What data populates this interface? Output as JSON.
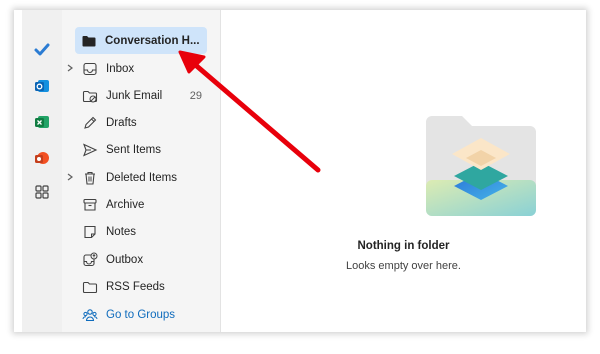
{
  "folders": [
    {
      "label": "Conversation H...",
      "icon": "folder-icon",
      "selected": true,
      "chevron": false
    },
    {
      "label": "Inbox",
      "icon": "inbox-icon",
      "chevron": true
    },
    {
      "label": "Junk Email",
      "icon": "junk-icon",
      "count": "29"
    },
    {
      "label": "Drafts",
      "icon": "pencil-icon"
    },
    {
      "label": "Sent Items",
      "icon": "send-icon"
    },
    {
      "label": "Deleted Items",
      "icon": "trash-icon",
      "chevron": true
    },
    {
      "label": "Archive",
      "icon": "archive-icon"
    },
    {
      "label": "Notes",
      "icon": "notes-icon"
    },
    {
      "label": "Outbox",
      "icon": "outbox-icon"
    },
    {
      "label": "RSS Feeds",
      "icon": "rss-folder-icon"
    },
    {
      "label": "Go to Groups",
      "icon": "groups-icon",
      "link": true
    }
  ],
  "rail": [
    "todo-check-icon",
    "outlook-app-icon",
    "excel-app-icon",
    "office-app-icon",
    "apps-grid-icon"
  ],
  "empty": {
    "title": "Nothing in folder",
    "subtitle": "Looks empty over here."
  },
  "colors": {
    "selected_bg": "#cfe4fa",
    "link": "#0f6cbd",
    "annotation_arrow": "#e8000b"
  }
}
